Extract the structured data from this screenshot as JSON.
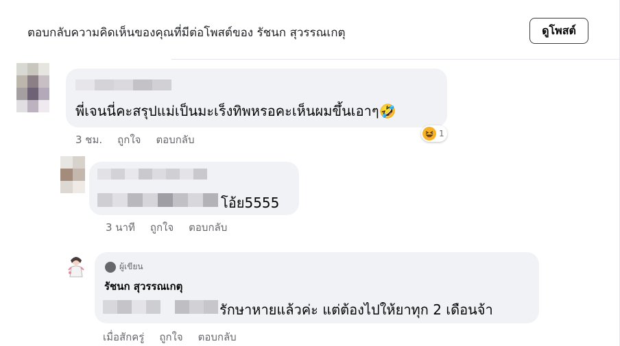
{
  "header": {
    "title": "ตอบกลับความคิดเห็นของคุณที่มีต่อโพสต์ของ รัชนก สุวรรณเกตุ",
    "view_post_label": "ดูโพสต์"
  },
  "comments": [
    {
      "text": "พี่เจนนี่คะสรุปแม่เป็นมะเร็งทิพหรอคะเห็นผมขึ้นเอาๆ🤣",
      "time": "3 ชม.",
      "like_label": "ถูกใจ",
      "reply_label": "ตอบกลับ",
      "reaction_count": "1"
    },
    {
      "text": "โอ้ย5555",
      "time": "3 นาที",
      "like_label": "ถูกใจ",
      "reply_label": "ตอบกลับ"
    },
    {
      "author_badge": "ผู้เขียน",
      "author_name": "รัชนก สุวรรณเกตุ",
      "text": "รักษาหายแล้วค่ะ แต่ต้องไปให้ยาทุก 2 เดือนจ้า",
      "time": "เมื่อสักครู่",
      "like_label": "ถูกใจ",
      "reply_label": "ตอบกลับ"
    }
  ],
  "colors": {
    "bubble": "#f0f2f5",
    "meta_text": "#65676b",
    "reaction_yellow": "#f7b125"
  },
  "icons": {
    "reaction": "laughing-face-icon",
    "emoji_in_text": "rofl-emoji-icon",
    "author_badge": "author-dot-icon"
  }
}
